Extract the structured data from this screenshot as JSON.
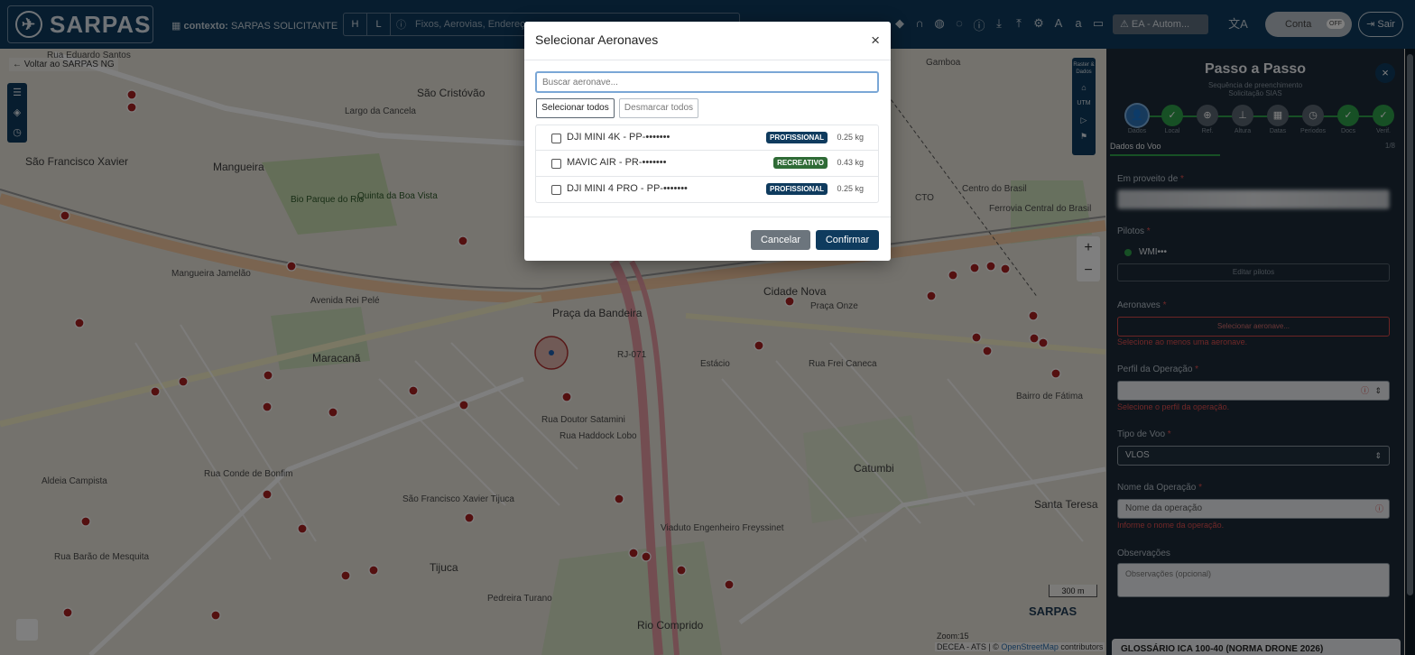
{
  "topbar": {
    "logo_text": "SARPAS",
    "context_label": "contexto:",
    "context_value": "SARPAS SOLICITANTE",
    "search_seg_h": "H",
    "search_seg_l": "L",
    "search_placeholder": "Fixos, Aerovias, Endereço",
    "ea_badge": "EA - Autom...",
    "account_label": "Conta",
    "account_toggle": "OFF",
    "exit_label": "Sair"
  },
  "map": {
    "back_link": "← Voltar ao SARPAS NG",
    "right_tools_top": "Raster & Dados",
    "right_tools_utm": "UTM",
    "zoom_in": "+",
    "zoom_out": "−",
    "scale": "300 m",
    "watermark": "SARPAS",
    "zoom_info": "Zoom:15",
    "attribution_prefix": "DECEA - ATS | ©",
    "attribution_osm": "OpenStreetMap",
    "attribution_suffix": "contributors",
    "labels": [
      "Rua Eduardo Santos",
      "São Cristóvão",
      "Largo da Cancela",
      "Mangueira",
      "São Francisco Xavier",
      "Bio Parque do Rio",
      "Quinta da Boa Vista",
      "Maracanã",
      "Mangueira Jamelão",
      "Avenida Rei Pelé",
      "Praça da Bandeira",
      "Estácio",
      "Cidade Nova",
      "Praça Onze",
      "Centro do Brasil",
      "Rua Frei Caneca",
      "Bairro de Fátima",
      "Tijuca",
      "Rio Comprido",
      "Catumbi",
      "Santa Teresa",
      "Gamboa",
      "Rua Haddock Lobo",
      "Rua Doutor Satamini",
      "Rua Conde de Bonfim",
      "Aldeia Campista",
      "Rua Barão de Mesquita",
      "Pedreira Turano",
      "São Francisco Xavier Tijuca",
      "Viaduto Engenheiro Freyssinet",
      "RJ-071",
      "CTO",
      "Ferrovia Central do Brasil"
    ]
  },
  "panel": {
    "title": "Passo a Passo",
    "subtitle": "Sequência de preenchimento",
    "subtitle2": "Solicitação SIAS",
    "close": "×",
    "steps": [
      {
        "label": "Dados",
        "icon": "👤",
        "state": "active"
      },
      {
        "label": "Local",
        "icon": "✓",
        "state": "done"
      },
      {
        "label": "Ref.",
        "icon": "⊕",
        "state": "todo"
      },
      {
        "label": "Altura",
        "icon": "⊥",
        "state": "todo"
      },
      {
        "label": "Datas",
        "icon": "▦",
        "state": "todo"
      },
      {
        "label": "Períodos",
        "icon": "◷",
        "state": "todo"
      },
      {
        "label": "Docs",
        "icon": "✓",
        "state": "done"
      },
      {
        "label": "Verif.",
        "icon": "✓",
        "state": "done"
      }
    ],
    "section": "Dados do Voo",
    "step_count": "1/8",
    "em_proveito_label": "Em proveito de",
    "pilotos_label": "Pilotos",
    "pilot_name": "WMI•••",
    "edit_pilots": "Editar pilotos",
    "aeronaves_label": "Aeronaves",
    "aeronaves_btn": "Selecionar aeronave...",
    "aeronaves_error": "Selecione ao menos uma aeronave.",
    "perfil_label": "Perfil da Operação",
    "perfil_error": "Selecione o perfil da operação.",
    "tipo_label": "Tipo de Voo",
    "tipo_value": "VLOS",
    "nome_label": "Nome da Operação",
    "nome_placeholder": "Nome da operação",
    "nome_error": "Informe o nome da operação.",
    "obs_label": "Observações",
    "obs_placeholder": "Observações (opcional)",
    "glossary": "GLOSSÁRIO ICA 100-40 (NORMA DRONE 2026)"
  },
  "modal": {
    "title": "Selecionar Aeronaves",
    "close": "×",
    "search_placeholder": "Buscar aeronave...",
    "select_all": "Selecionar todos",
    "deselect_all": "Desmarcar todos",
    "aircraft": [
      {
        "name": "DJI MINI 4K - PP-•••••••",
        "category": "PROFISSIONAL",
        "weight": "0.25 kg"
      },
      {
        "name": "MAVIC AIR - PR-•••••••",
        "category": "RECREATIVO",
        "weight": "0.43 kg"
      },
      {
        "name": "DJI MINI 4 PRO - PP-•••••••",
        "category": "PROFISSIONAL",
        "weight": "0.25 kg"
      }
    ],
    "cancel": "Cancelar",
    "confirm": "Confirmar"
  }
}
